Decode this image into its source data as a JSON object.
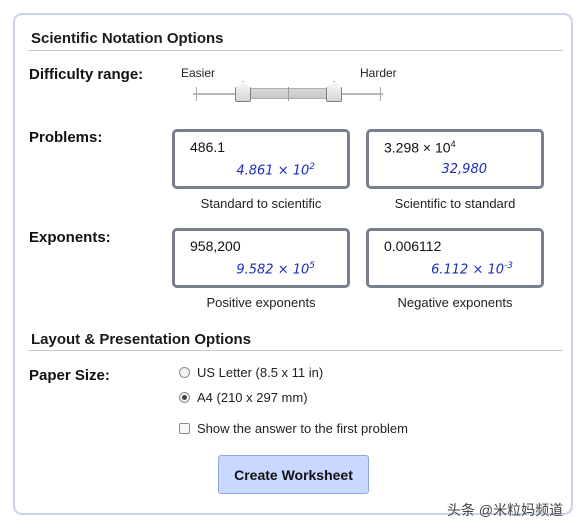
{
  "sections": {
    "scientific_title": "Scientific Notation Options",
    "layout_title": "Layout & Presentation Options"
  },
  "difficulty": {
    "label": "Difficulty range:",
    "easier": "Easier",
    "harder": "Harder",
    "range_low": 0.25,
    "range_high": 0.74
  },
  "problems": {
    "label": "Problems:",
    "cards": [
      {
        "question": "486.1",
        "answer_mantissa": "4.861 × 10",
        "answer_exp": "2",
        "caption": "Standard to scientific"
      },
      {
        "question_mantissa": "3.298 × 10",
        "question_exp": "4",
        "answer": "32,980",
        "caption": "Scientific to standard"
      }
    ]
  },
  "exponents": {
    "label": "Exponents:",
    "cards": [
      {
        "question": "958,200",
        "answer_mantissa": "9.582 × 10",
        "answer_exp": "5",
        "caption": "Positive exponents"
      },
      {
        "question": "0.006112",
        "answer_mantissa": "6.112 × 10",
        "answer_exp": "-3",
        "caption": "Negative exponents"
      }
    ]
  },
  "paper": {
    "label": "Paper Size:",
    "options": [
      {
        "label": "US Letter (8.5 x 11 in)",
        "selected": false
      },
      {
        "label": "A4 (210 x 297 mm)",
        "selected": true
      }
    ]
  },
  "show_answer": {
    "label": "Show the answer to the first problem",
    "checked": false
  },
  "create_button": "Create Worksheet",
  "watermark": "头条 @米粒妈频道"
}
